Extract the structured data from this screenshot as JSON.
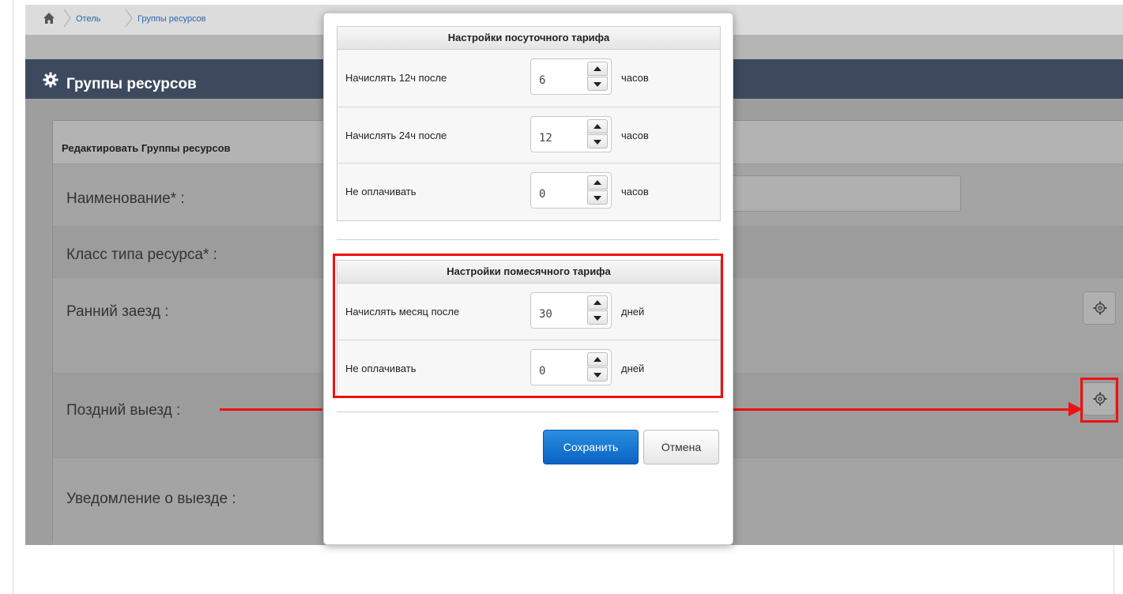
{
  "breadcrumb": {
    "items": [
      "Отель",
      "Группы ресурсов"
    ]
  },
  "page": {
    "title": "Группы ресурсов"
  },
  "form": {
    "heading": "Редактировать Группы ресурсов",
    "fields": [
      {
        "label": "Наименование* :"
      },
      {
        "label": "Класс типа ресурса* :"
      },
      {
        "label": "Ранний заезд :"
      },
      {
        "label": "Поздний выезд :"
      },
      {
        "label": "Уведомление о выезде :"
      }
    ]
  },
  "modal": {
    "daily": {
      "title": "Настройки посуточного тарифа",
      "rows": [
        {
          "label": "Начислять 12ч после",
          "value": "6",
          "unit": "часов"
        },
        {
          "label": "Начислять 24ч после",
          "value": "12",
          "unit": "часов"
        },
        {
          "label": "Не оплачивать",
          "value": "0",
          "unit": "часов"
        }
      ]
    },
    "monthly": {
      "title": "Настройки помесячного тарифа",
      "rows": [
        {
          "label": "Начислять месяц после",
          "value": "30",
          "unit": "дней"
        },
        {
          "label": "Не оплачивать",
          "value": "0",
          "unit": "дней"
        }
      ]
    },
    "save_label": "Сохранить",
    "cancel_label": "Отмена"
  },
  "colors": {
    "title_bar": "#3d4a5e",
    "primary_button": "#0a62c4",
    "highlight": "#e11111"
  }
}
